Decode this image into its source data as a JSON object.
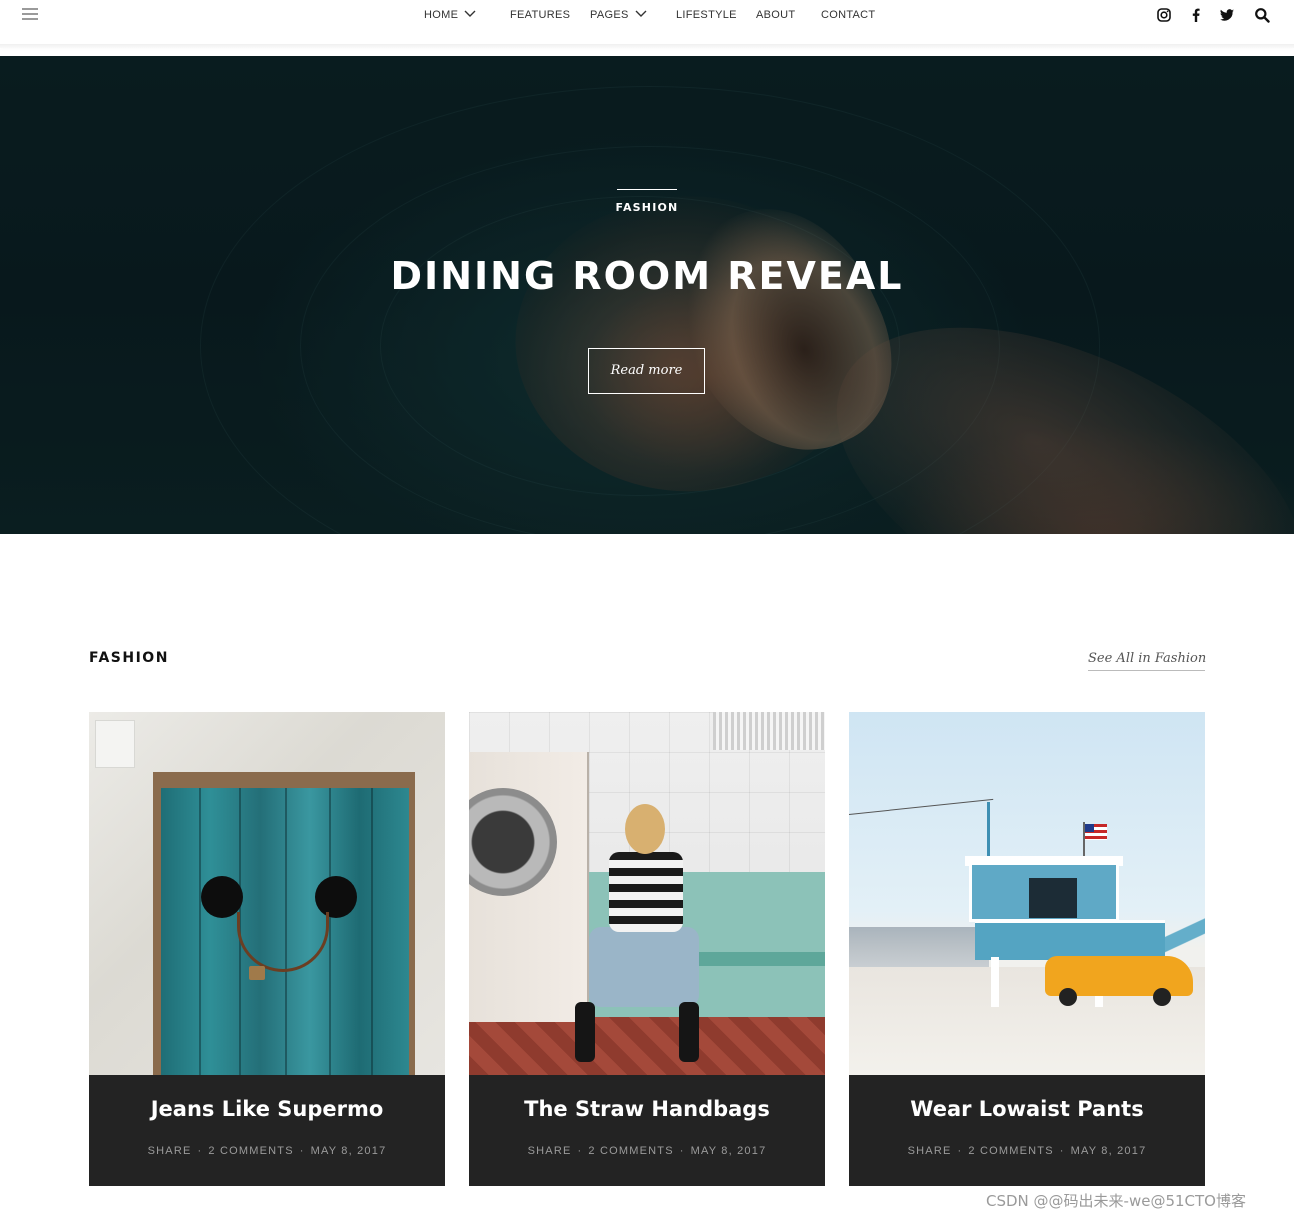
{
  "nav": {
    "items": [
      {
        "label": "HOME",
        "has_dropdown": true
      },
      {
        "label": "FEATURES",
        "has_dropdown": false
      },
      {
        "label": "PAGES",
        "has_dropdown": true
      },
      {
        "label": "LIFESTYLE",
        "has_dropdown": false
      },
      {
        "label": "ABOUT",
        "has_dropdown": false
      },
      {
        "label": "CONTACT",
        "has_dropdown": false
      }
    ],
    "social_icons": [
      "instagram-icon",
      "facebook-icon",
      "twitter-icon",
      "search-icon"
    ]
  },
  "hero": {
    "category": "FASHION",
    "title": "DINING ROOM REVEAL",
    "button": "Read more"
  },
  "section": {
    "title": "FASHION",
    "see_all": "See All in Fashion"
  },
  "cards": [
    {
      "title": "Jeans Like Supermo",
      "share": "SHARE",
      "comments": "2 COMMENTS",
      "date": "MAY 8, 2017"
    },
    {
      "title": "The Straw Handbags",
      "share": "SHARE",
      "comments": "2 COMMENTS",
      "date": "MAY 8, 2017"
    },
    {
      "title": "Wear Lowaist Pants",
      "share": "SHARE",
      "comments": "2 COMMENTS",
      "date": "MAY 8, 2017"
    }
  ],
  "watermark": "CSDN @@码出未来-we@51CTO博客",
  "colors": {
    "caption_bg": "#232323",
    "hero_bg": "#0d2226",
    "meta_text": "#9b9b9b"
  }
}
